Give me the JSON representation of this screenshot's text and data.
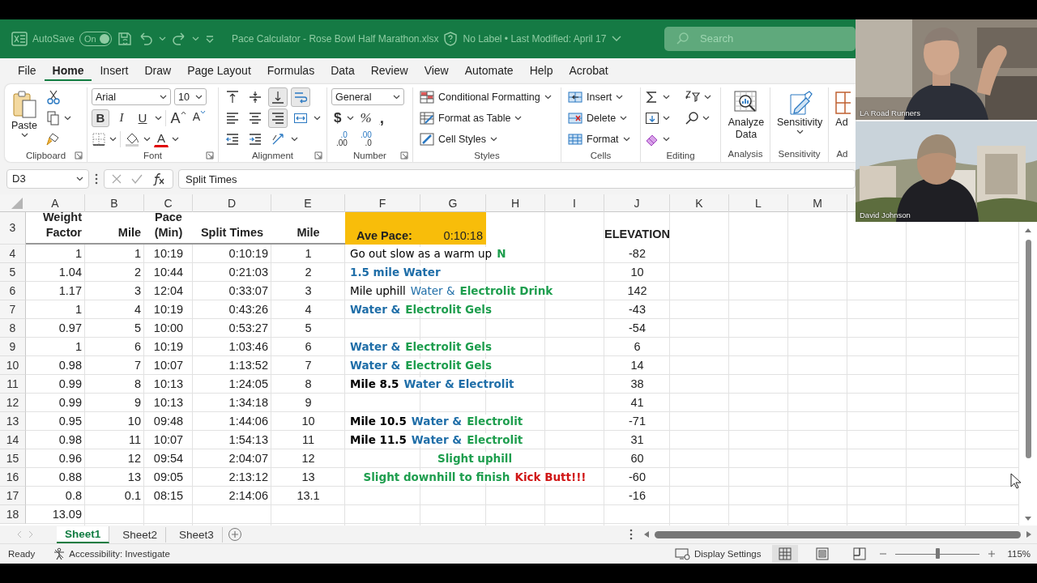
{
  "title_bar": {
    "autosave_label": "AutoSave",
    "autosave": {
      "on": true,
      "text": "On"
    },
    "file_title": "Pace Calculator - Rose Bowl Half Marathon.xlsx",
    "sensitivity_label": "No Label • Last Modified: April 17",
    "search_text": "Search"
  },
  "menu_tabs": [
    {
      "label": "File",
      "selected": false
    },
    {
      "label": "Home",
      "selected": true
    },
    {
      "label": "Insert",
      "selected": false
    },
    {
      "label": "Draw",
      "selected": false
    },
    {
      "label": "Page Layout",
      "selected": false
    },
    {
      "label": "Formulas",
      "selected": false
    },
    {
      "label": "Data",
      "selected": false
    },
    {
      "label": "Review",
      "selected": false
    },
    {
      "label": "View",
      "selected": false
    },
    {
      "label": "Automate",
      "selected": false
    },
    {
      "label": "Help",
      "selected": false
    },
    {
      "label": "Acrobat",
      "selected": false
    }
  ],
  "ribbon": {
    "groups": [
      {
        "kind": "clipboard",
        "label": "Clipboard",
        "paste": "Paste"
      },
      {
        "kind": "font",
        "label": "Font",
        "font_name": "Arial",
        "font_size": "10",
        "styles": [
          {
            "label": "B",
            "selected": true
          },
          {
            "label": "I",
            "selected": false
          },
          {
            "label": "U",
            "selected": false
          }
        ],
        "grow": "A",
        "shrink": "A",
        "font_color": "A"
      },
      {
        "kind": "alignment",
        "label": "Alignment",
        "rows": [
          [
            {
              "kind": "top",
              "selected": false
            },
            {
              "kind": "middle",
              "selected": false
            },
            {
              "kind": "bottom",
              "selected": true
            },
            {
              "kind": "wrap",
              "selected": true
            }
          ],
          [
            {
              "kind": "left",
              "selected": false
            },
            {
              "kind": "center",
              "selected": false
            },
            {
              "kind": "right",
              "selected": true
            },
            {
              "kind": "merge",
              "selected": false
            }
          ],
          [
            {
              "kind": "outdent",
              "selected": false
            },
            {
              "kind": "indent",
              "selected": false
            },
            {
              "kind": "orientation",
              "selected": false
            }
          ]
        ]
      },
      {
        "kind": "number",
        "label": "Number",
        "format": "General",
        "symbols": [
          "$",
          "%",
          ","
        ],
        "decimals": [
          {
            "top": ".0",
            "bottom": ".00"
          },
          {
            "top": ".00",
            "bottom": ".0"
          }
        ]
      },
      {
        "kind": "styles",
        "label": "Styles",
        "items": [
          "Conditional Formatting",
          "Format as Table",
          "Cell Styles"
        ]
      },
      {
        "kind": "cells",
        "label": "Cells",
        "items": [
          "Insert",
          "Delete",
          "Format"
        ]
      },
      {
        "kind": "editing",
        "label": "Editing"
      },
      {
        "kind": "analysis",
        "label": "Analysis",
        "button": "Analyze Data"
      },
      {
        "kind": "sensitivity",
        "label": "Sensitivity",
        "button": "Sensitivity"
      },
      {
        "kind": "addins",
        "label": "Ad",
        "button": "Ad"
      }
    ]
  },
  "formula_bar": {
    "name_box": "D3",
    "formula": "Split Times"
  },
  "columns": [
    "A",
    "B",
    "C",
    "D",
    "E",
    "F",
    "G",
    "H",
    "I",
    "J",
    "K",
    "L",
    "M"
  ],
  "header_row": {
    "number": "3",
    "labels": [
      "Weight Factor",
      "Mile",
      "Pace (Min)",
      "Split Times",
      "Mile"
    ],
    "ave_pace_label": "Ave Pace:",
    "ave_pace_value": "0:10:18",
    "elevation_label": "ELEVATION"
  },
  "rows": [
    {
      "number": "4",
      "values": [
        "1",
        "1",
        "10:19",
        "0:10:19",
        "1"
      ],
      "note": {
        "kind": "plain",
        "segments": [
          {
            "text": "Go out slow as a warm up",
            "color": "#000000",
            "bold": false
          },
          {
            "text": "N",
            "color": "#1e9e4e",
            "bold": true
          }
        ]
      },
      "elevation": "-82"
    },
    {
      "number": "5",
      "values": [
        "1.04",
        "2",
        "10:44",
        "0:21:03",
        "2"
      ],
      "note": {
        "kind": "plain",
        "segments": [
          {
            "text": "1.5 mile Water",
            "color": "#1f6ea8",
            "bold": true
          }
        ]
      },
      "elevation": "10"
    },
    {
      "number": "6",
      "values": [
        "1.17",
        "3",
        "12:04",
        "0:33:07",
        "3"
      ],
      "note": {
        "kind": "plain",
        "segments": [
          {
            "text": "Mile uphill",
            "color": "#000000",
            "bold": false
          },
          {
            "text": "Water &",
            "color": "#1f6ea8",
            "bold": false
          },
          {
            "text": "Electrolit Drink",
            "color": "#1e9e4e",
            "bold": true
          }
        ]
      },
      "elevation": "142"
    },
    {
      "number": "7",
      "values": [
        "1",
        "4",
        "10:19",
        "0:43:26",
        "4"
      ],
      "note": {
        "kind": "plain",
        "segments": [
          {
            "text": "Water &",
            "color": "#1f6ea8",
            "bold": true
          },
          {
            "text": "Electrolit Gels",
            "color": "#1e9e4e",
            "bold": true
          }
        ]
      },
      "elevation": "-43"
    },
    {
      "number": "8",
      "values": [
        "0.97",
        "5",
        "10:00",
        "0:53:27",
        "5"
      ],
      "elevation": "-54"
    },
    {
      "number": "9",
      "values": [
        "1",
        "6",
        "10:19",
        "1:03:46",
        "6"
      ],
      "note": {
        "kind": "plain",
        "segments": [
          {
            "text": "Water &",
            "color": "#1f6ea8",
            "bold": true
          },
          {
            "text": "Electrolit Gels",
            "color": "#1e9e4e",
            "bold": true
          }
        ]
      },
      "elevation": "6"
    },
    {
      "number": "10",
      "values": [
        "0.98",
        "7",
        "10:07",
        "1:13:52",
        "7"
      ],
      "note": {
        "kind": "plain",
        "segments": [
          {
            "text": "Water &",
            "color": "#1f6ea8",
            "bold": true
          },
          {
            "text": "Electrolit Gels",
            "color": "#1e9e4e",
            "bold": true
          }
        ]
      },
      "elevation": "14"
    },
    {
      "number": "11",
      "values": [
        "0.99",
        "8",
        "10:13",
        "1:24:05",
        "8"
      ],
      "note": {
        "kind": "plain",
        "segments": [
          {
            "text": "Mile 8.5",
            "color": "#000000",
            "bold": true
          },
          {
            "text": "Water & Electrolit",
            "color": "#1f6ea8",
            "bold": true
          }
        ]
      },
      "elevation": "38"
    },
    {
      "number": "12",
      "values": [
        "0.99",
        "9",
        "10:13",
        "1:34:18",
        "9"
      ],
      "elevation": "41"
    },
    {
      "number": "13",
      "values": [
        "0.95",
        "10",
        "09:48",
        "1:44:06",
        "10"
      ],
      "note": {
        "kind": "plain",
        "segments": [
          {
            "text": "Mile 10.5",
            "color": "#000000",
            "bold": true
          },
          {
            "text": "Water &",
            "color": "#1f6ea8",
            "bold": true
          },
          {
            "text": "Electrolit",
            "color": "#1e9e4e",
            "bold": true
          }
        ]
      },
      "elevation": "-71"
    },
    {
      "number": "14",
      "values": [
        "0.98",
        "11",
        "10:07",
        "1:54:13",
        "11"
      ],
      "note": {
        "kind": "plain",
        "segments": [
          {
            "text": "Mile 11.5",
            "color": "#000000",
            "bold": true
          },
          {
            "text": "Water &",
            "color": "#1f6ea8",
            "bold": true
          },
          {
            "text": "Electrolit",
            "color": "#1e9e4e",
            "bold": true
          }
        ]
      },
      "elevation": "31"
    },
    {
      "number": "15",
      "values": [
        "0.96",
        "12",
        "09:54",
        "2:04:07",
        "12"
      ],
      "note": {
        "kind": "centered",
        "segments": [
          {
            "text": "Slight uphill",
            "color": "#1e9e4e",
            "bold": true
          }
        ]
      },
      "elevation": "60"
    },
    {
      "number": "16",
      "values": [
        "0.88",
        "13",
        "09:05",
        "2:13:12",
        "13"
      ],
      "note": {
        "kind": "centered",
        "segments": [
          {
            "text": "Slight downhill to finish",
            "color": "#1e9e4e",
            "bold": true
          },
          {
            "text": "Kick Butt!!!",
            "color": "#d01515",
            "bold": true
          }
        ]
      },
      "elevation": "-60"
    },
    {
      "number": "17",
      "values": [
        "0.8",
        "0.1",
        "08:15",
        "2:14:06",
        "13.1"
      ],
      "elevation": "-16"
    },
    {
      "number": "18",
      "values": [
        "13.09"
      ]
    }
  ],
  "sheet_tabs": [
    {
      "label": "Sheet1",
      "selected": true
    },
    {
      "label": "Sheet2",
      "selected": false
    },
    {
      "label": "Sheet3",
      "selected": false
    }
  ],
  "status_bar": {
    "ready": "Ready",
    "accessibility": "Accessibility: Investigate",
    "display_settings": "Display Settings",
    "views": [
      {
        "kind": "normal",
        "selected": true
      },
      {
        "kind": "page_layout",
        "selected": false
      },
      {
        "kind": "page_break",
        "selected": false
      }
    ],
    "zoom": {
      "level": 0.5,
      "reading": "115%"
    }
  },
  "video_tiles": [
    {
      "kind": "indoor",
      "name": "LA Road Runners"
    },
    {
      "kind": "outdoor",
      "name": "David Johnson"
    }
  ]
}
